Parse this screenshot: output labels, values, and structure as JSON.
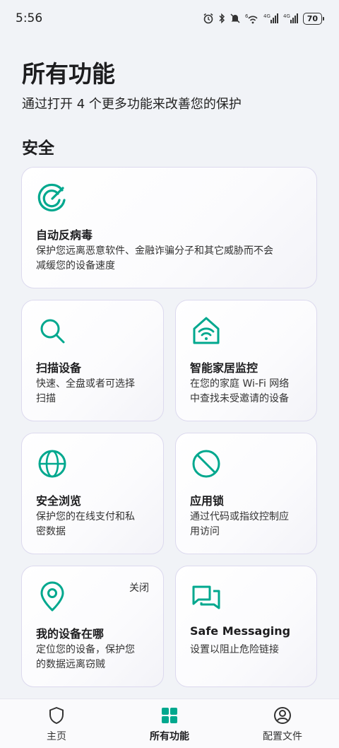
{
  "status_bar": {
    "time": "5:56",
    "signal1": "4G",
    "signal2": "4G",
    "wifi_badge": "6",
    "battery": "70"
  },
  "header": {
    "title": "所有功能",
    "subtitle": "通过打开 4 个更多功能来改善您的保护"
  },
  "section": {
    "title": "安全"
  },
  "features": {
    "antivirus": {
      "icon": "radar-icon",
      "title": "自动反病毒",
      "desc_line1": "保护您远离恶意软件、金融诈骗分子和其它威胁而不会",
      "desc_line2": "减缓您的设备速度"
    },
    "scan": {
      "icon": "search-icon",
      "title": "扫描设备",
      "desc_line1": "快速、全盘或者可选择",
      "desc_line2": "扫描"
    },
    "smart_home": {
      "icon": "home-wifi-icon",
      "title": "智能家居监控",
      "desc_line1": "在您的家庭 Wi-Fi 网络",
      "desc_line2": "中查找未受邀请的设备"
    },
    "safe_browsing": {
      "icon": "globe-icon",
      "title": "安全浏览",
      "desc_line1": "保护您的在线支付和私",
      "desc_line2": "密数据"
    },
    "app_lock": {
      "icon": "block-icon",
      "title": "应用锁",
      "desc_line1": "通过代码或指纹控制应",
      "desc_line2": "用访问"
    },
    "find_device": {
      "icon": "location-pin-icon",
      "title": "我的设备在哪",
      "status": "关闭",
      "desc_line1": "定位您的设备，保护您",
      "desc_line2": "的数据远离窃贼"
    },
    "safe_messaging": {
      "icon": "chat-bubbles-icon",
      "title": "Safe Messaging",
      "desc_line1": "设置以阻止危险链接"
    }
  },
  "bottom_nav": {
    "home": "主页",
    "all_features": "所有功能",
    "profile": "配置文件",
    "active": "all_features"
  },
  "colors": {
    "accent": "#00a88e",
    "background": "#f1f3f7",
    "card_border": "#dcd9ee"
  }
}
